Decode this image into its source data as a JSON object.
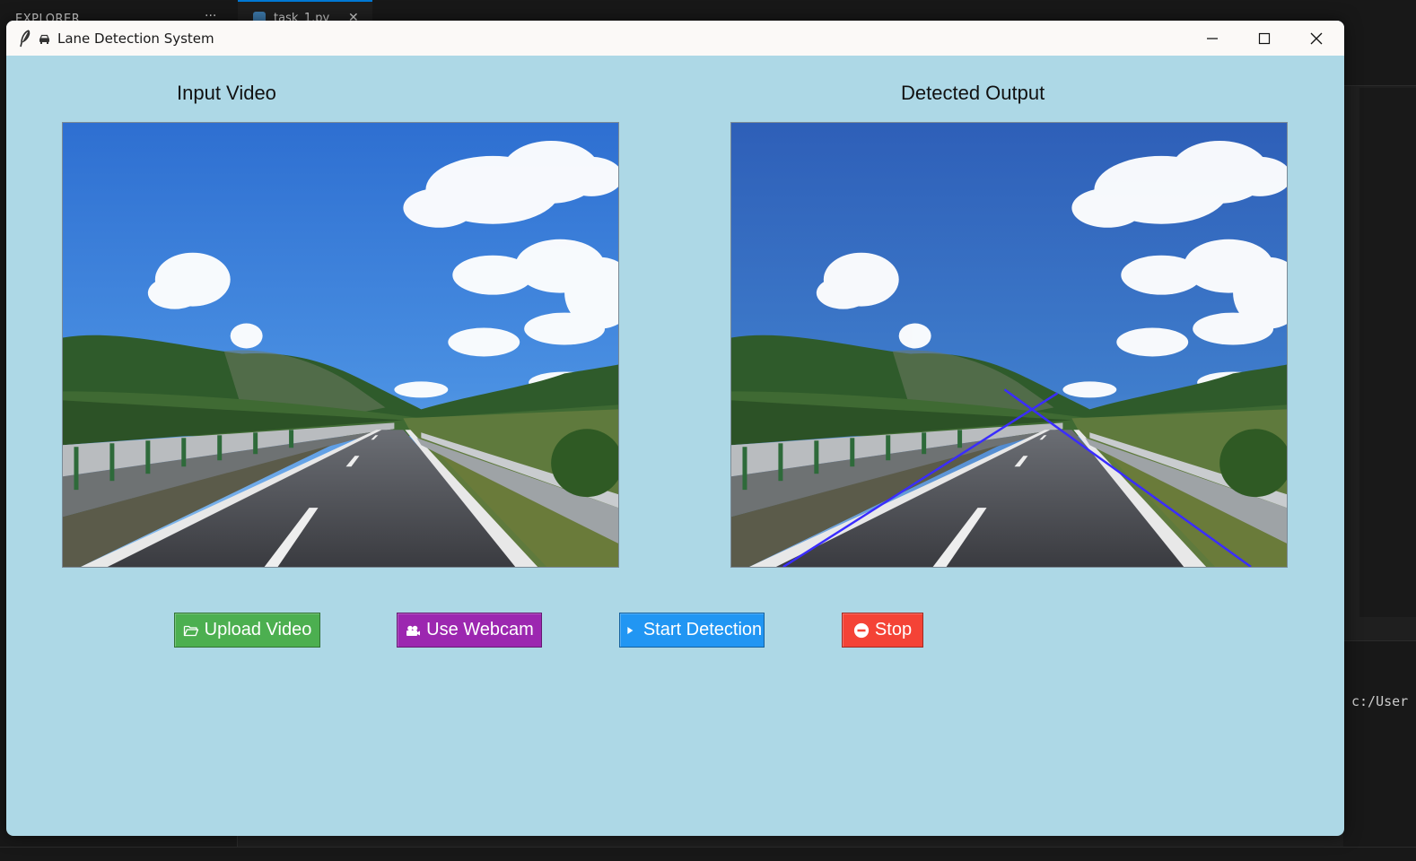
{
  "ide": {
    "explorer_label": "EXPLORER",
    "explorer_more": "···",
    "tab_label": "task_1.py",
    "tab_close": "✕",
    "terminal_text": "c:/User"
  },
  "window": {
    "title": "Lane Detection System"
  },
  "panels": {
    "input_title": "Input Video",
    "output_title": "Detected Output"
  },
  "buttons": {
    "upload": "Upload Video",
    "webcam": "Use Webcam",
    "start": "Start Detection",
    "stop": "Stop"
  },
  "icons": {
    "upload": "folder-open-icon",
    "webcam": "camera-icon",
    "start": "play-icon",
    "stop": "no-entry-icon",
    "title": "car-icon",
    "app": "feather-icon"
  },
  "colors": {
    "window_bg": "#add8e6",
    "upload": "#4caf50",
    "webcam": "#9c27b0",
    "start": "#2196f3",
    "stop": "#f44336",
    "lane_line": "#3a2cff"
  }
}
